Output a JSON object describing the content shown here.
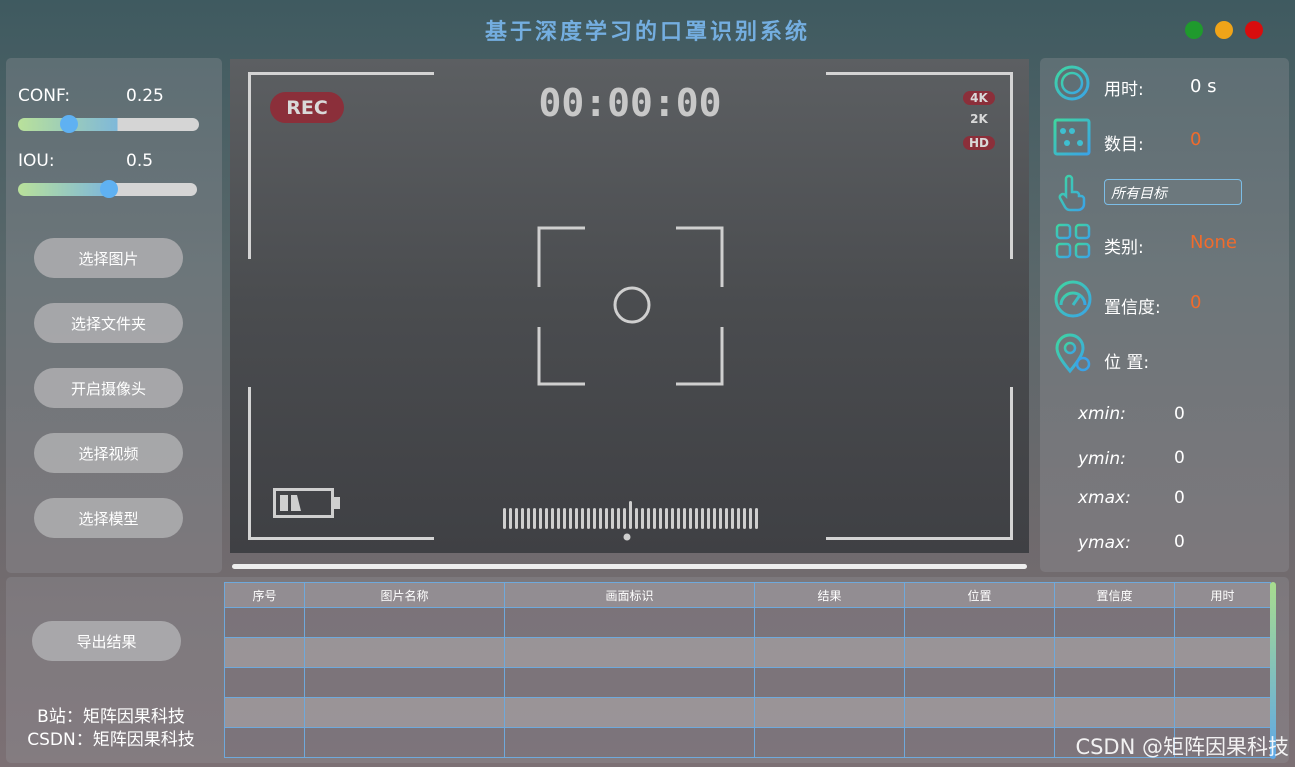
{
  "app": {
    "title": "基于深度学习的口罩识别系统",
    "window_controls": [
      {
        "name": "minimize",
        "color": "#1f9a2d"
      },
      {
        "name": "maximize",
        "color": "#f0a418"
      },
      {
        "name": "close",
        "color": "#d80d0d"
      }
    ]
  },
  "params": {
    "conf_label": "CONF:",
    "conf_value": "0.25",
    "conf_level": 0.25,
    "iou_label": "IOU:",
    "iou_value": "0.5",
    "iou_level": 0.5
  },
  "buttons": {
    "select_image": "选择图片",
    "select_folder": "选择文件夹",
    "open_camera": "开启摄像头",
    "select_video": "选择视频",
    "select_model": "选择模型",
    "export_results": "导出结果"
  },
  "camera": {
    "rec": "REC",
    "timer": "00:00:00",
    "res_4k": "4K",
    "res_2k": "2K",
    "res_hd": "HD"
  },
  "info": {
    "time_label": "用时:",
    "time_value": "0 s",
    "count_label": "数目:",
    "count_value": "0",
    "target_select": "所有目标",
    "class_label": "类别:",
    "class_value": "None",
    "conf_label": "置信度:",
    "conf_value": "0",
    "pos_label": "位 置:",
    "xmin_label": "xmin:",
    "xmin_value": "0",
    "ymin_label": "ymin:",
    "ymin_value": "0",
    "xmax_label": "xmax:",
    "xmax_value": "0",
    "ymax_label": "ymax:",
    "ymax_value": "0"
  },
  "table": {
    "headers": [
      "序号",
      "图片名称",
      "画面标识",
      "结果",
      "位置",
      "置信度",
      "用时"
    ]
  },
  "footer": {
    "bilibili": "B站：矩阵因果科技",
    "csdn": "CSDN：矩阵因果科技",
    "watermark": "CSDN @矩阵因果科技"
  },
  "colors": {
    "title": "#74aee0",
    "accent_orange": "#f06b2c",
    "slider_knob": "#5fb1f2",
    "rec_badge": "#8b2f3a"
  }
}
